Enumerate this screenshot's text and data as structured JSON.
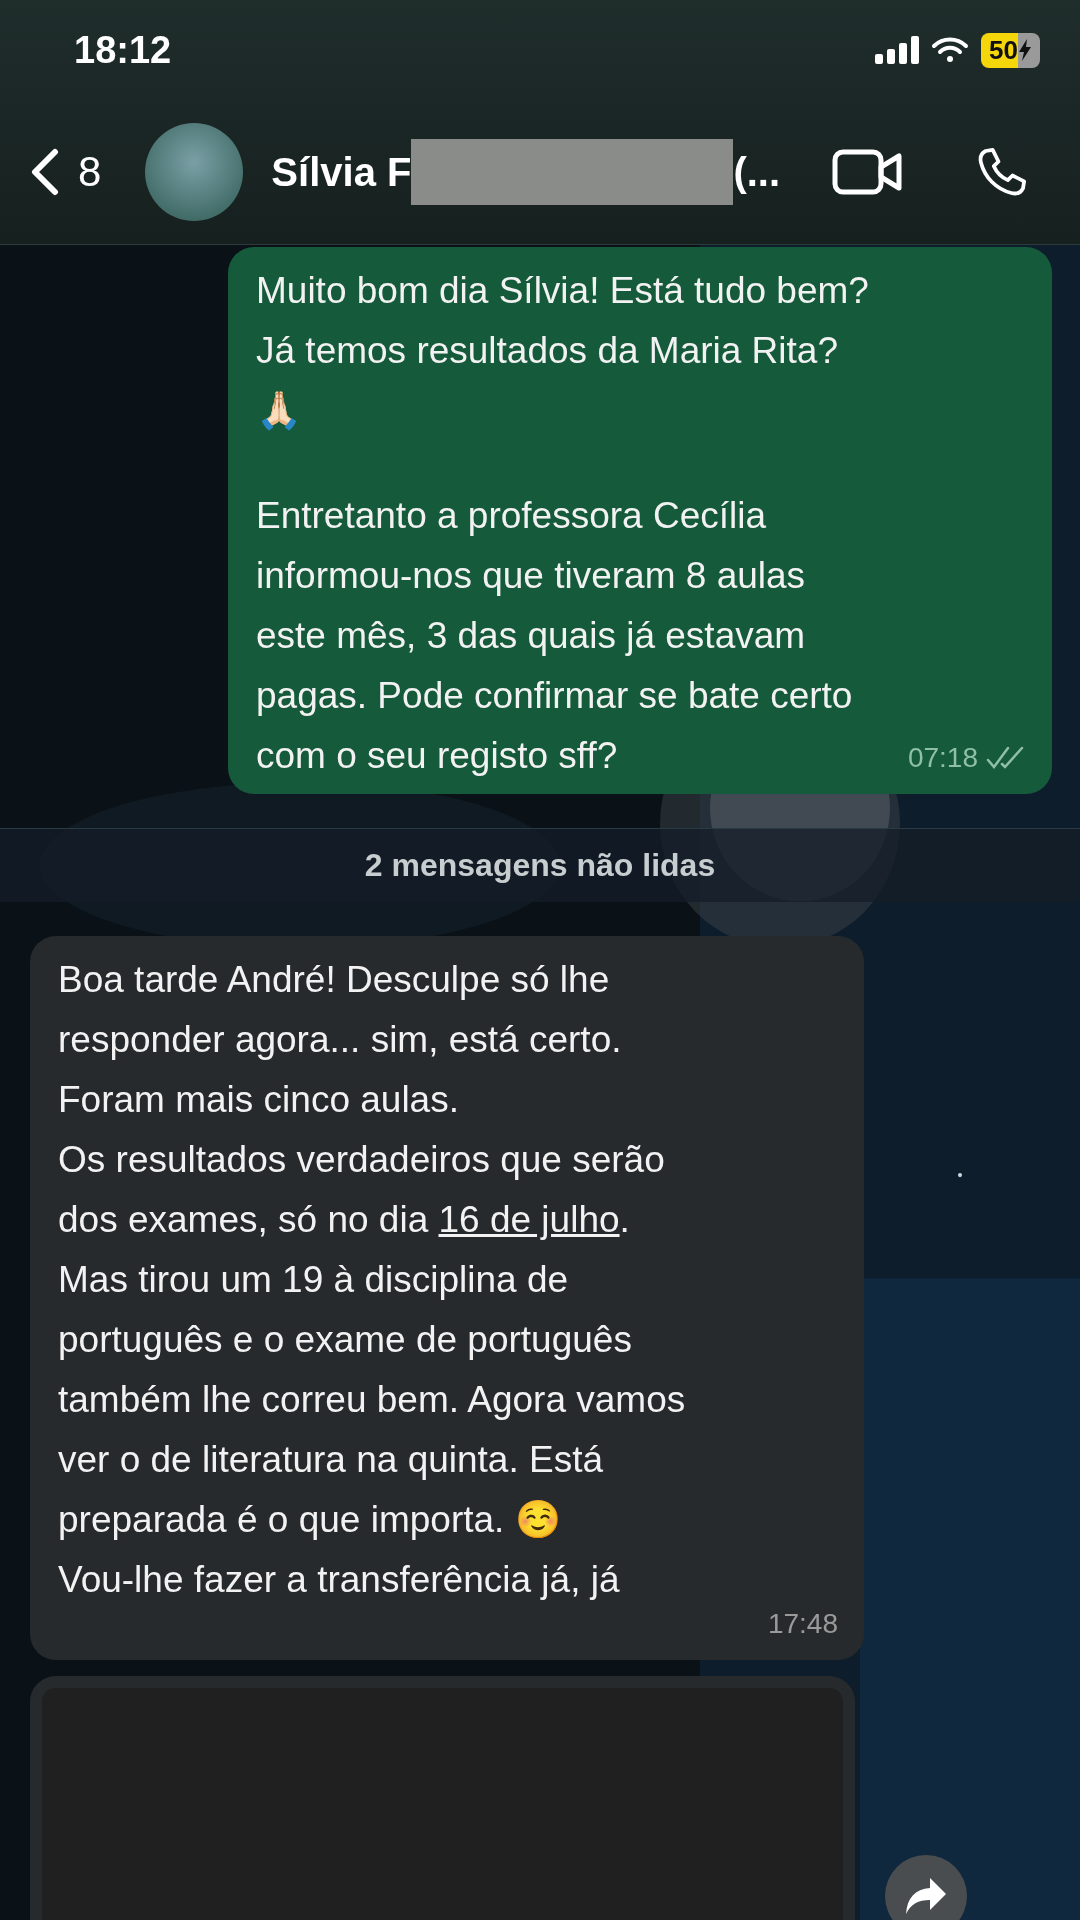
{
  "status_bar": {
    "time": "18:12",
    "battery": "50"
  },
  "header": {
    "back_count": "8",
    "contact_name": "Sílvia F",
    "name_suffix": "(..."
  },
  "messages": [
    {
      "kind": "outgoing",
      "paragraphs": [
        [
          [
            {
              "text": "Muito bom dia Sílvia! Está tudo bem?"
            }
          ],
          [
            {
              "text": "Já temos resultados da Maria Rita?"
            }
          ],
          [
            {
              "text": "🙏🏻"
            }
          ]
        ],
        [
          [
            {
              "text": "Entretanto a professora Cecília"
            }
          ],
          [
            {
              "text": "informou-nos que tiveram 8 aulas"
            }
          ],
          [
            {
              "text": "este mês, 3 das quais já estavam"
            }
          ],
          [
            {
              "text": "pagas. Pode confirmar se bate certo"
            }
          ],
          [
            {
              "text": "com o seu registo sff?"
            }
          ]
        ]
      ],
      "time": "07:18"
    },
    {
      "kind": "divider",
      "text": "2 mensagens não lidas"
    },
    {
      "kind": "incoming",
      "paragraphs": [
        [
          [
            {
              "text": "Boa tarde André! Desculpe só lhe"
            }
          ],
          [
            {
              "text": "responder agora... sim, está certo."
            }
          ],
          [
            {
              "text": "Foram mais cinco aulas."
            }
          ],
          [
            {
              "text": "Os resultados verdadeiros que serão"
            }
          ],
          [
            {
              "text": "dos exames, só no dia "
            },
            {
              "text": "16 de julho",
              "link": true
            },
            {
              "text": "."
            }
          ],
          [
            {
              "text": "Mas tirou um 19 à disciplina de"
            }
          ],
          [
            {
              "text": "português e o exame de português"
            }
          ],
          [
            {
              "text": "também lhe correu bem. Agora vamos"
            }
          ],
          [
            {
              "text": "ver o de literatura na quinta. Está"
            }
          ],
          [
            {
              "text": "preparada é o que importa. ☺️"
            }
          ],
          [
            {
              "text": "Vou-lhe fazer a transferência já, já"
            }
          ]
        ]
      ],
      "time": "17:48"
    },
    {
      "kind": "media"
    }
  ]
}
